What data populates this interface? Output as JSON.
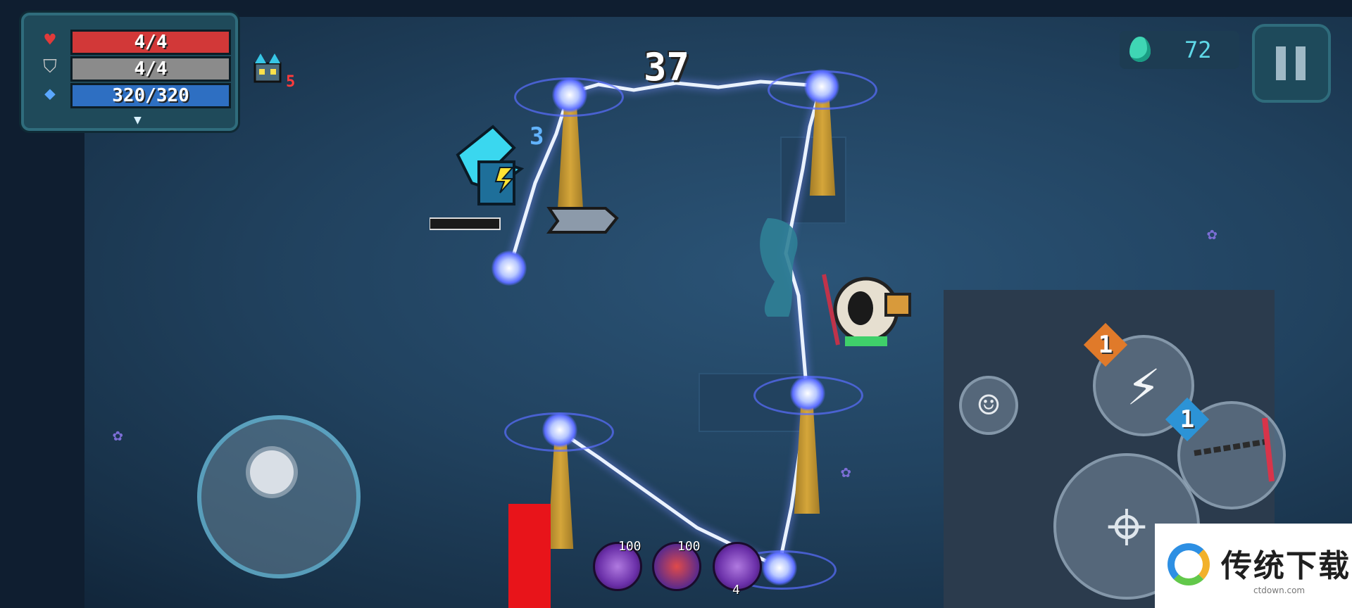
{
  "hud": {
    "health": "4/4",
    "armor": "4/4",
    "energy": "320/320",
    "health_icon": "heart-icon",
    "armor_icon": "shield-icon",
    "energy_icon": "diamond-icon"
  },
  "buff": {
    "count": "5"
  },
  "gems": {
    "value": "72",
    "icon": "gem-icon"
  },
  "damage_number": "37",
  "player_marker": "3",
  "skill_badge": "1",
  "weapon_badge": "1",
  "potions": [
    {
      "label": "100"
    },
    {
      "label": "100"
    },
    {
      "label": "4"
    }
  ],
  "watermark": {
    "text": "传统下载",
    "url": "ctdown.com"
  },
  "colors": {
    "hp": "#d23838",
    "armor": "#8b8b8b",
    "energy": "#2e6fc2",
    "lightning": "#eaf2ff"
  }
}
